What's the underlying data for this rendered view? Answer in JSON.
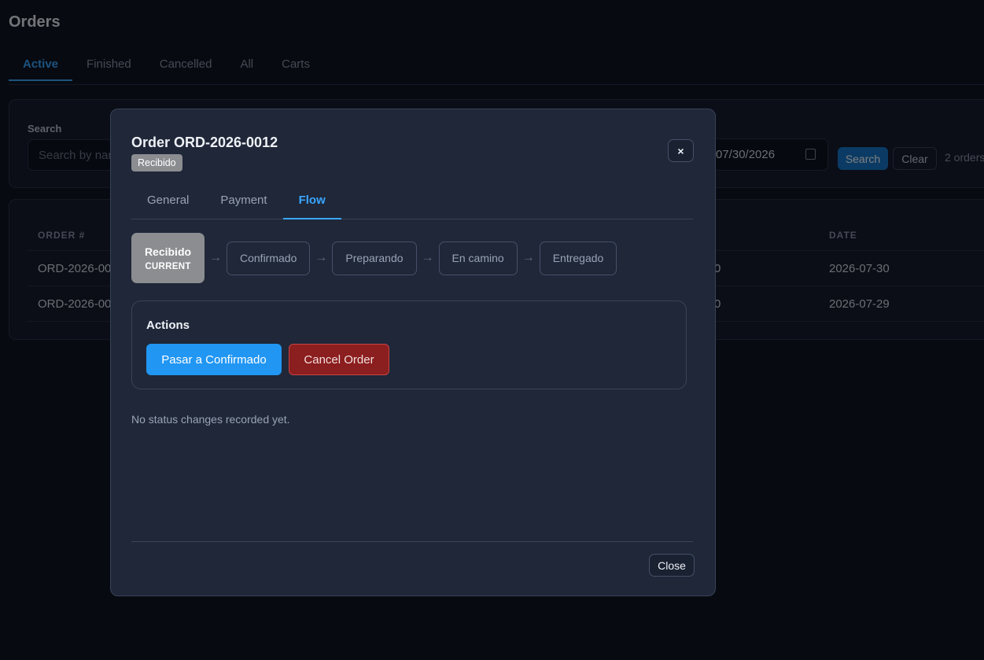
{
  "page": {
    "title": "Orders",
    "tabs": [
      {
        "label": "Active"
      },
      {
        "label": "Finished"
      },
      {
        "label": "Cancelled"
      },
      {
        "label": "All"
      },
      {
        "label": "Carts"
      }
    ],
    "active_tab": "Active"
  },
  "filters": {
    "search_label": "Search",
    "search_placeholder": "Search by name",
    "date_value": "07/30/2026",
    "search_button": "Search",
    "clear_button": "Clear",
    "count_text": "2 orders"
  },
  "table": {
    "headers": {
      "order": "ORDER #",
      "date": "DATE"
    },
    "rows": [
      {
        "order": "ORD-2026-0012",
        "amount_tail": "0",
        "date": "2026-07-30"
      },
      {
        "order": "ORD-2026-0011",
        "amount_tail": "0",
        "date": "2026-07-29"
      }
    ]
  },
  "modal": {
    "title": "Order ORD-2026-0012",
    "status_badge": "Recibido",
    "close_x": "×",
    "tabs": [
      {
        "label": "General"
      },
      {
        "label": "Payment"
      },
      {
        "label": "Flow"
      }
    ],
    "active_tab": "Flow",
    "flow": {
      "steps": [
        "Recibido",
        "Confirmado",
        "Preparando",
        "En camino",
        "Entregado"
      ],
      "current_index": 0,
      "current_tag": "CURRENT",
      "arrow": "→"
    },
    "actions": {
      "title": "Actions",
      "advance_button": "Pasar a Confirmado",
      "cancel_button": "Cancel Order"
    },
    "history_empty": "No status changes recorded yet.",
    "close_button": "Close"
  },
  "colors": {
    "accent": "#3aa6ff",
    "primary_button": "#2196f3",
    "danger": "#8b1e1e",
    "status_badge": "#8b8d91"
  }
}
